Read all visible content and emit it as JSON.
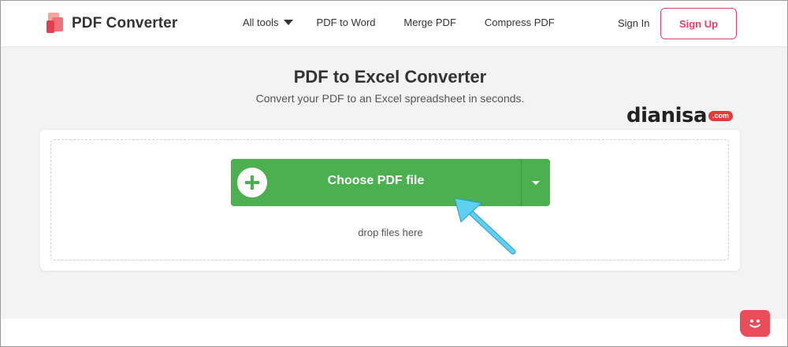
{
  "brand": {
    "name": "PDF Converter"
  },
  "nav": {
    "all_tools": "All tools",
    "pdf_to_word": "PDF to Word",
    "merge_pdf": "Merge PDF",
    "compress_pdf": "Compress PDF"
  },
  "auth": {
    "sign_in": "Sign In",
    "sign_up": "Sign Up"
  },
  "hero": {
    "title": "PDF to Excel Converter",
    "subtitle": "Convert your PDF to an Excel spreadsheet in seconds."
  },
  "watermark": {
    "text": "dianisa",
    "suffix": ".com"
  },
  "upload": {
    "choose_label": "Choose PDF file",
    "drop_hint": "drop files here"
  },
  "colors": {
    "accent": "#e5416a",
    "button_green": "#4caf50",
    "arrow": "#4fc3e8",
    "chat": "#ea4c5a"
  },
  "icons": [
    "logo-icon",
    "chevron-down-icon",
    "plus-icon",
    "pointer-arrow-icon",
    "chat-icon"
  ]
}
